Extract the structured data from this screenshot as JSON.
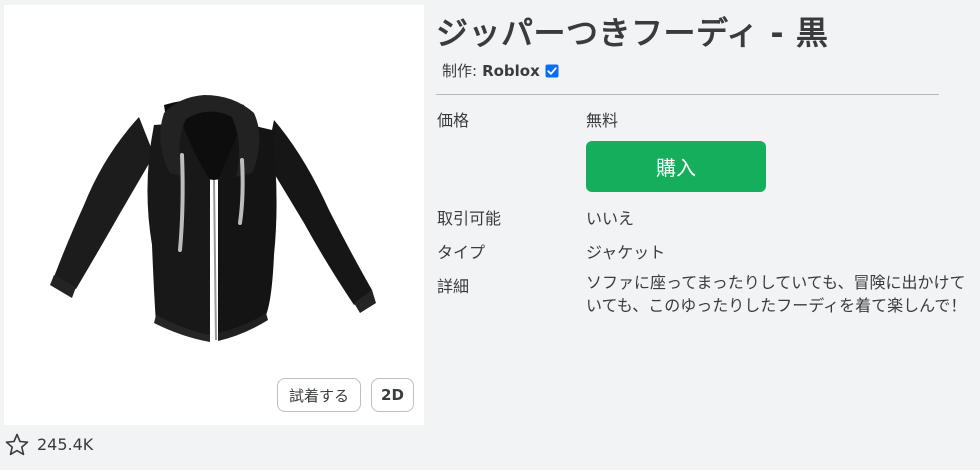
{
  "item": {
    "title": "ジッパーつきフーディ - 黒",
    "creator_prefix": "制作:",
    "creator_name": "Roblox",
    "creator_verified": true
  },
  "thumbnail": {
    "try_on_label": "試着する",
    "view_2d_label": "2D",
    "favorite_count": "245.4K"
  },
  "details": {
    "price_label": "価格",
    "price_value": "無料",
    "buy_label": "購入",
    "tradable_label": "取引可能",
    "tradable_value": "いいえ",
    "type_label": "タイプ",
    "type_value": "ジャケット",
    "description_label": "詳細",
    "description_value": "ソファに座ってまったりしていても、冒険に出かけていても、このゆったりしたフーディを着て楽しんで！"
  },
  "colors": {
    "buy_button": "#14ae5c",
    "verified_badge": "#0b6cf5",
    "page_background": "#f2f3f4"
  }
}
